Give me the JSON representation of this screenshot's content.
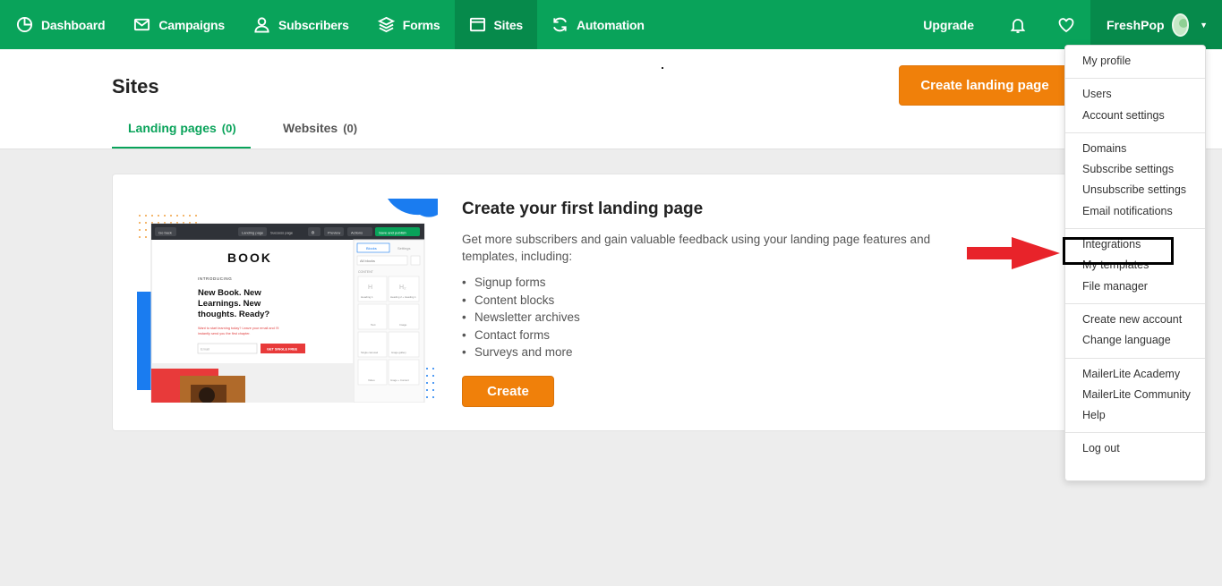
{
  "nav": {
    "items": [
      {
        "label": "Dashboard",
        "icon": "dashboard-icon"
      },
      {
        "label": "Campaigns",
        "icon": "mail-icon"
      },
      {
        "label": "Subscribers",
        "icon": "user-icon"
      },
      {
        "label": "Forms",
        "icon": "layers-icon"
      },
      {
        "label": "Sites",
        "icon": "browser-window-icon",
        "active": true
      },
      {
        "label": "Automation",
        "icon": "refresh-icon"
      }
    ],
    "upgrade": "Upgrade",
    "account_name": "FreshPop"
  },
  "header": {
    "title": "Sites",
    "create_button": "Create landing page",
    "tabs": [
      {
        "label": "Landing pages",
        "count": "(0)"
      },
      {
        "label": "Websites",
        "count": "(0)"
      }
    ]
  },
  "card": {
    "title": "Create your first landing page",
    "description": "Get more subscribers and gain valuable feedback using your landing page features and templates, including:",
    "features": [
      "Signup forms",
      "Content blocks",
      "Newsletter archives",
      "Contact forms",
      "Surveys and more"
    ],
    "create_button": "Create"
  },
  "illustration": {
    "go_back": "Go back",
    "landing_page": "Landing page",
    "success_page": "Success page",
    "preview": "Preview",
    "actions": "Actions",
    "save_publish": "Save and publish",
    "tab_blocks": "Blocks",
    "tab_settings": "Settings",
    "all_blocks": "All blocks",
    "content": "CONTENT",
    "logo": "BOOK",
    "introducing": "INTRODUCING",
    "headline": "New Book. New Learnings. New thoughts. Ready?",
    "red_text": "Want to start learning today? Leave your email and I'll instantly send you the first chapter.",
    "email_placeholder": "Email",
    "cta": "GET SINGLE FREE",
    "block_labels": [
      "Heading 1",
      "Heading 2 + Heading 1",
      "Text",
      "Image",
      "Single carousel",
      "Image gallery",
      "Video",
      "Image + Content"
    ]
  },
  "dropdown": {
    "groups": [
      [
        "My profile"
      ],
      [
        "Users",
        "Account settings"
      ],
      [
        "Domains",
        "Subscribe settings",
        "Unsubscribe settings",
        "Email notifications"
      ],
      [
        "Integrations",
        "My templates",
        "File manager"
      ],
      [
        "Create new account",
        "Change language"
      ],
      [
        "MailerLite Academy",
        "MailerLite Community",
        "Help"
      ],
      [
        "Log out"
      ]
    ]
  },
  "colors": {
    "brand_green": "#09a35a",
    "active_green": "#068a4b",
    "orange": "#f0800a",
    "annotation_red": "#e8232a"
  }
}
